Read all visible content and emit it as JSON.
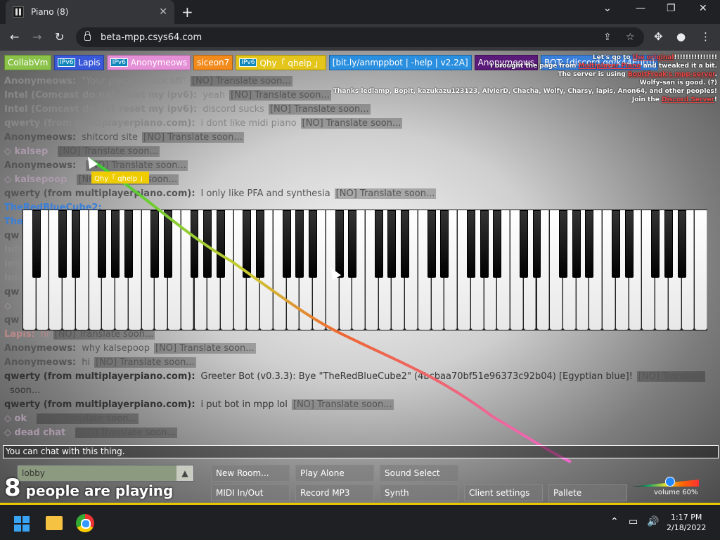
{
  "browser": {
    "tab_title": "Piano (8)",
    "url": "beta-mpp.csys64.com"
  },
  "badges": [
    {
      "label": "CollabVm",
      "color": "#8bc34a",
      "ipv6": false,
      "prefix": "Me"
    },
    {
      "label": "Lapis",
      "color": "#3a59d9",
      "ipv6": true
    },
    {
      "label": "Anonymeows",
      "color": "#e48fd6",
      "ipv6": true
    },
    {
      "label": "siceon7",
      "color": "#f28a1c",
      "ipv6": false
    },
    {
      "label": "Qhy「 qhelp 」",
      "color": "#e3c51b",
      "ipv6": true
    },
    {
      "label": "[bit.ly/anmppbot | -help | v2.2A]",
      "color": "#2b8fe0",
      "ipv6": false
    },
    {
      "label": "Anonymeows",
      "color": "#5a1a7a",
      "ipv6": false
    },
    {
      "label": "BOT: [discord.gg/k44Eutu]",
      "color": "#3a7fd9",
      "ipv6": false
    }
  ],
  "motd": {
    "line1_pre": "Let's go to ",
    "line1_link": "the original",
    "line1_post": "!!!!!!!!!!!!!!!",
    "line2_pre": "I brought the page from ",
    "line2_link": "Multiplayer Piano",
    "line2_post": " and tweaked it a bit.",
    "line3_pre": "The server is using ",
    "line3_link": "BopItFreak's mpp-server",
    "line3_post": ".",
    "line4": "Wolfy-san is good. (?)",
    "line5": "Thanks ledlamp, BopIt, kazukazu123123, AlvierD, Chacha, Wolfy, Charsy, lapis, Anon64, and other peoples!",
    "line6_pre": "Join the ",
    "line6_link": "Discord Server",
    "line6_post": "!"
  },
  "chat": [
    {
      "name": "Anonymeows:",
      "text": "\"Your place to fuck off\"",
      "tr": "[NO] Translate soon...",
      "color": "#888"
    },
    {
      "name": "Intel (Comcast do not reset my ipv6):",
      "text": "yeah",
      "tr": "[NO] Translate soon...",
      "color": "#888"
    },
    {
      "name": "Intel (Comcast do not reset my ipv6):",
      "text": "discord sucks",
      "tr": "[NO] Translate soon...",
      "color": "#888"
    },
    {
      "name": "qwerty (from multiplayerpiano.com):",
      "text": "i dont like midi piano",
      "tr": "[NO] Translate soon...",
      "color": "#888"
    },
    {
      "name": "Anonymeows:",
      "text": "shitcord site",
      "tr": "[NO] Translate soon...",
      "color": "#555"
    },
    {
      "name": "◇ kalsep",
      "text": "",
      "tr": "[NO] Translate soon...",
      "color": "#a9a"
    },
    {
      "name": "Anonymeows:",
      "text": "",
      "tr": "[NO] Translate soon...",
      "color": "#555"
    },
    {
      "name": "◇ kalsepoop",
      "text": "",
      "tr": "[NO] Translate soon...",
      "color": "#a9a"
    },
    {
      "name": "qwerty (from multiplayerpiano.com):",
      "text": "I only like PFA and synthesia",
      "tr": "[NO] Translate soon...",
      "color": "#555"
    },
    {
      "name": "TheRedBlueCube2:",
      "text": "",
      "tr": "",
      "color": "#3a7fd9"
    },
    {
      "name": "The",
      "text": "",
      "tr": "",
      "color": "#3a7fd9"
    },
    {
      "name": "qw",
      "text": "",
      "tr": "",
      "color": "#555"
    },
    {
      "name": "Intel",
      "text": "",
      "tr": "",
      "color": "#888"
    },
    {
      "name": "Intel",
      "text": "",
      "tr": "",
      "color": "#888"
    },
    {
      "name": "Intel",
      "text": "",
      "tr": "",
      "color": "#888"
    },
    {
      "name": "qw",
      "text": "",
      "tr": "",
      "color": "#555"
    },
    {
      "name": "◇",
      "text": "",
      "tr": "",
      "color": "#a9a"
    },
    {
      "name": "qw",
      "text": "",
      "tr": "",
      "color": "#555"
    },
    {
      "name": "Lapis:",
      "text": "hi",
      "tr": "[NO] Translate soon...",
      "color": "#b88"
    },
    {
      "name": "Anonymeows:",
      "text": "why kalsepoop",
      "tr": "[NO] Translate soon...",
      "color": "#555"
    },
    {
      "name": "Anonymeows:",
      "text": "hi",
      "tr": "[NO] Translate soon...",
      "color": "#555"
    },
    {
      "name": "qwerty (from multiplayerpiano.com):",
      "text": "Greeter Bot (v0.3.3): Bye \"TheRedBlueCube2\" (4bcbaa70bf51e96373c92b04) [Egyptian blue]!",
      "tr": "[NO] Translate",
      "color": "#333"
    },
    {
      "name": "",
      "text": "soon...",
      "tr": "",
      "color": "#333"
    },
    {
      "name": "qwerty (from multiplayerpiano.com):",
      "text": "i put bot in mpp lol",
      "tr": "[NO] Translate soon...",
      "color": "#333"
    },
    {
      "name": "◇ ok",
      "text": "",
      "tr": "[NO] Translate soon...",
      "color": "#a9a"
    },
    {
      "name": "◇ dead chat",
      "text": "",
      "tr": "[NO] Translate soon...",
      "color": "#a9a"
    }
  ],
  "cursor_tag": "Qhy「 qhelp 」",
  "chat_input": {
    "value": "You can chat with this thing."
  },
  "room": {
    "name": "lobby"
  },
  "playing": {
    "count": "8",
    "text": "people are playing"
  },
  "buttons": {
    "new_room": "New Room...",
    "play_alone": "Play Alone",
    "sound_select": "Sound Select",
    "midi": "MIDI In/Out",
    "record": "Record MP3",
    "synth": "Synth",
    "client_settings": "Client settings",
    "pallete": "Pallete"
  },
  "volume": {
    "label": "volume 60%",
    "level": 0.6
  },
  "taskbar": {
    "time": "1:17 PM",
    "date": "2/18/2022"
  }
}
